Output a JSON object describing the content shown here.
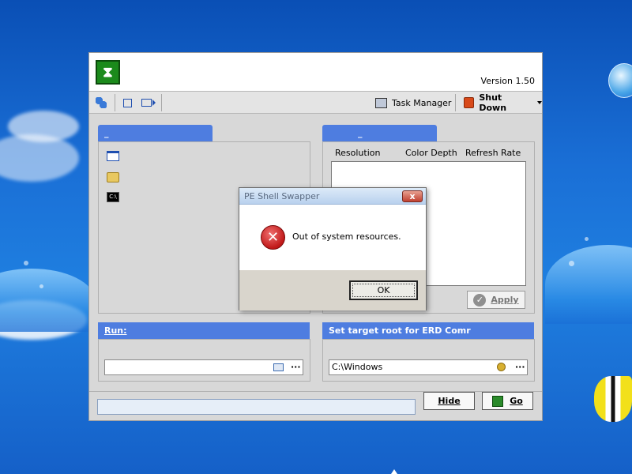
{
  "app": {
    "version": "Version 1.50",
    "logo_glyph": "⧗"
  },
  "toolbar": {
    "task_manager_label": "Task Manager",
    "shut_down_label": "Shut Down"
  },
  "left_panel": {
    "tab_label": "_"
  },
  "display_panel": {
    "tab_label": "_",
    "columns": [
      "Resolution",
      "Color Depth",
      "Refresh Rate"
    ],
    "apply_label": "Apply"
  },
  "run_panel": {
    "header": "Run:",
    "value": ""
  },
  "target_panel": {
    "header": "Set target root for ERD Comr",
    "value": "C:\\Windows"
  },
  "bottom": {
    "hide_label": "Hide",
    "go_label": "Go"
  },
  "dialog": {
    "title": "PE Shell Swapper",
    "message": "Out of system resources.",
    "ok_label": "OK",
    "close_glyph": "x"
  }
}
